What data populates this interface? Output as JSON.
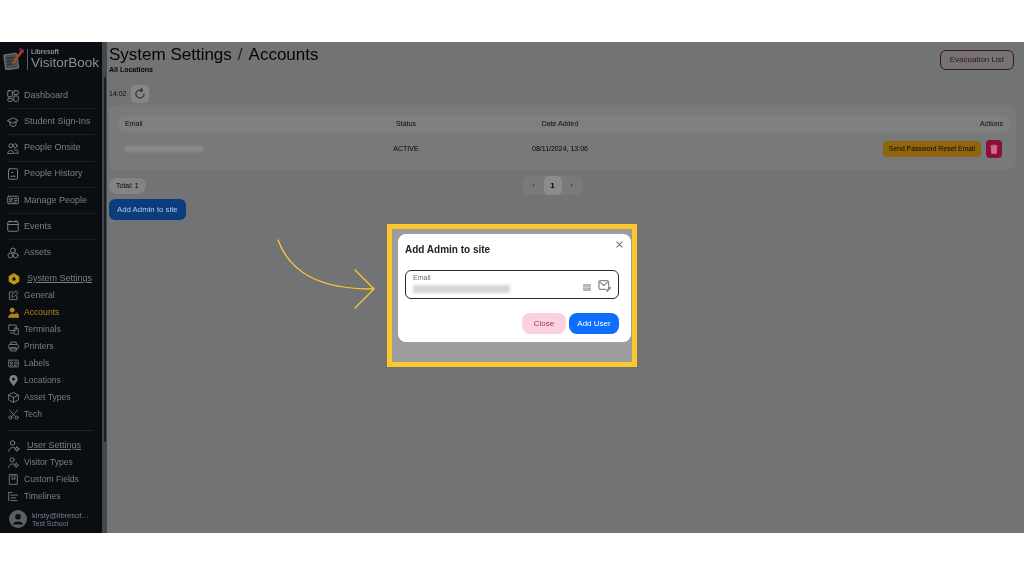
{
  "sidebar": {
    "logo": {
      "brand": "Libresoft",
      "product": "VisitorBook"
    },
    "items": [
      {
        "label": "Dashboard",
        "selected": false
      },
      {
        "label": "Student Sign-Ins",
        "selected": false
      },
      {
        "label": "People Onsite",
        "selected": false
      },
      {
        "label": "People History",
        "selected": false
      },
      {
        "label": "Manage People",
        "selected": false
      },
      {
        "label": "Events",
        "selected": false
      },
      {
        "label": "Assets",
        "selected": false
      }
    ],
    "sections": [
      {
        "label": "System Settings",
        "selected": true,
        "children": [
          {
            "label": "General",
            "selected": false
          },
          {
            "label": "Accounts",
            "selected": true
          },
          {
            "label": "Terminals",
            "selected": false
          },
          {
            "label": "Printers",
            "selected": false
          },
          {
            "label": "Labels",
            "selected": false
          },
          {
            "label": "Locations",
            "selected": false
          },
          {
            "label": "Asset Types",
            "selected": false
          },
          {
            "label": "Tech",
            "selected": false
          }
        ]
      },
      {
        "label": "User Settings",
        "selected": false,
        "children": [
          {
            "label": "Visitor Types",
            "selected": false
          },
          {
            "label": "Custom Fields",
            "selected": false
          },
          {
            "label": "Timelines",
            "selected": false
          }
        ]
      }
    ],
    "user": {
      "email": "kirsty@libresof…",
      "school": "Test School"
    }
  },
  "header": {
    "breadcrumb": [
      "System Settings",
      "Accounts"
    ],
    "separator": "/",
    "subtitle": "All Locations",
    "evacuation_button": "Evacuation List"
  },
  "refresh": {
    "time": "14:02"
  },
  "table": {
    "columns": [
      "Email",
      "Status",
      "Date Added",
      "Actions"
    ],
    "rows": [
      {
        "status": "ACTIVE",
        "date_added": "08/11/2024, 13:06",
        "reset_button": "Send Password Reset Email"
      }
    ]
  },
  "total": "Total: 1",
  "pagination": [
    {
      "label": "‹",
      "selected": false,
      "disabled": true
    },
    {
      "label": "1",
      "selected": true,
      "disabled": false
    },
    {
      "label": "›",
      "selected": false,
      "disabled": true
    }
  ],
  "add_button": "Add Admin to site",
  "modal": {
    "title": "Add Admin to site",
    "field": {
      "label": "Email"
    },
    "buttons": [
      {
        "label": "Close",
        "kind": "secondary"
      },
      {
        "label": "Add User",
        "kind": "primary"
      }
    ]
  }
}
